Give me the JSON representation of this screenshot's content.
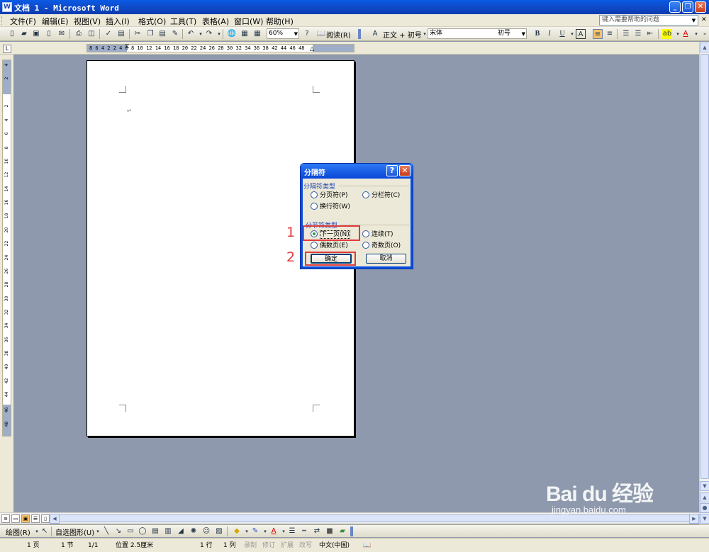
{
  "window": {
    "title": "文档 1 - Microsoft Word"
  },
  "menu": {
    "items": [
      "文件(F)",
      "编辑(E)",
      "视图(V)",
      "插入(I)",
      "格式(O)",
      "工具(T)",
      "表格(A)",
      "窗口(W)",
      "帮助(H)"
    ],
    "help_placeholder": "键入需要帮助的问题"
  },
  "toolbar": {
    "zoom": "60%",
    "read_label": "阅读(R)",
    "style": "正文 + 初号",
    "font": "宋体",
    "size": "初号",
    "bold": "B",
    "italic": "I",
    "underline": "U",
    "char_border": "A",
    "font_color": "A"
  },
  "ruler": {
    "ticks": "8  6  4  2     2  4  6  8  10  12  14  16  18  20  22  24  26  28  30  32  34  36  38     42  44  46  48",
    "vticks": [
      "4",
      "2",
      "2",
      "4",
      "6",
      "8",
      "10",
      "12",
      "14",
      "16",
      "18",
      "20",
      "22",
      "24",
      "26",
      "28",
      "30",
      "32",
      "34",
      "36",
      "38",
      "40",
      "42",
      "44",
      "46",
      "48"
    ]
  },
  "document": {
    "paragraph_mark": "↵"
  },
  "dialog": {
    "title": "分隔符",
    "group1": "分隔符类型",
    "opt_page": "分页符(P)",
    "opt_column": "分栏符(C)",
    "opt_wrap": "换行符(W)",
    "group2": "分节符类型",
    "opt_next": "下一页(N)",
    "opt_continuous": "连续(T)",
    "opt_even": "偶数页(E)",
    "opt_odd": "奇数页(O)",
    "ok": "确定",
    "cancel": "取消"
  },
  "annotations": {
    "step1": "1",
    "step2": "2"
  },
  "drawbar": {
    "draw": "绘图(R)",
    "autoshapes": "自选图形(U)"
  },
  "status": {
    "page": "1 页",
    "section": "1 节",
    "page_of": "1/1",
    "position": "位置 2.5厘米",
    "line": "1 行",
    "col": "1 列",
    "rec": "录制",
    "trk": "修订",
    "ext": "扩展",
    "ovr": "改写",
    "lang": "中文(中国)"
  },
  "watermark": {
    "brand": "Bai du 经验",
    "url": "jingyan.baidu.com"
  },
  "colors": {
    "highlight_red": "#e23a3a",
    "title_blue": "#0a4ee0",
    "workspace": "#8e99ad"
  }
}
